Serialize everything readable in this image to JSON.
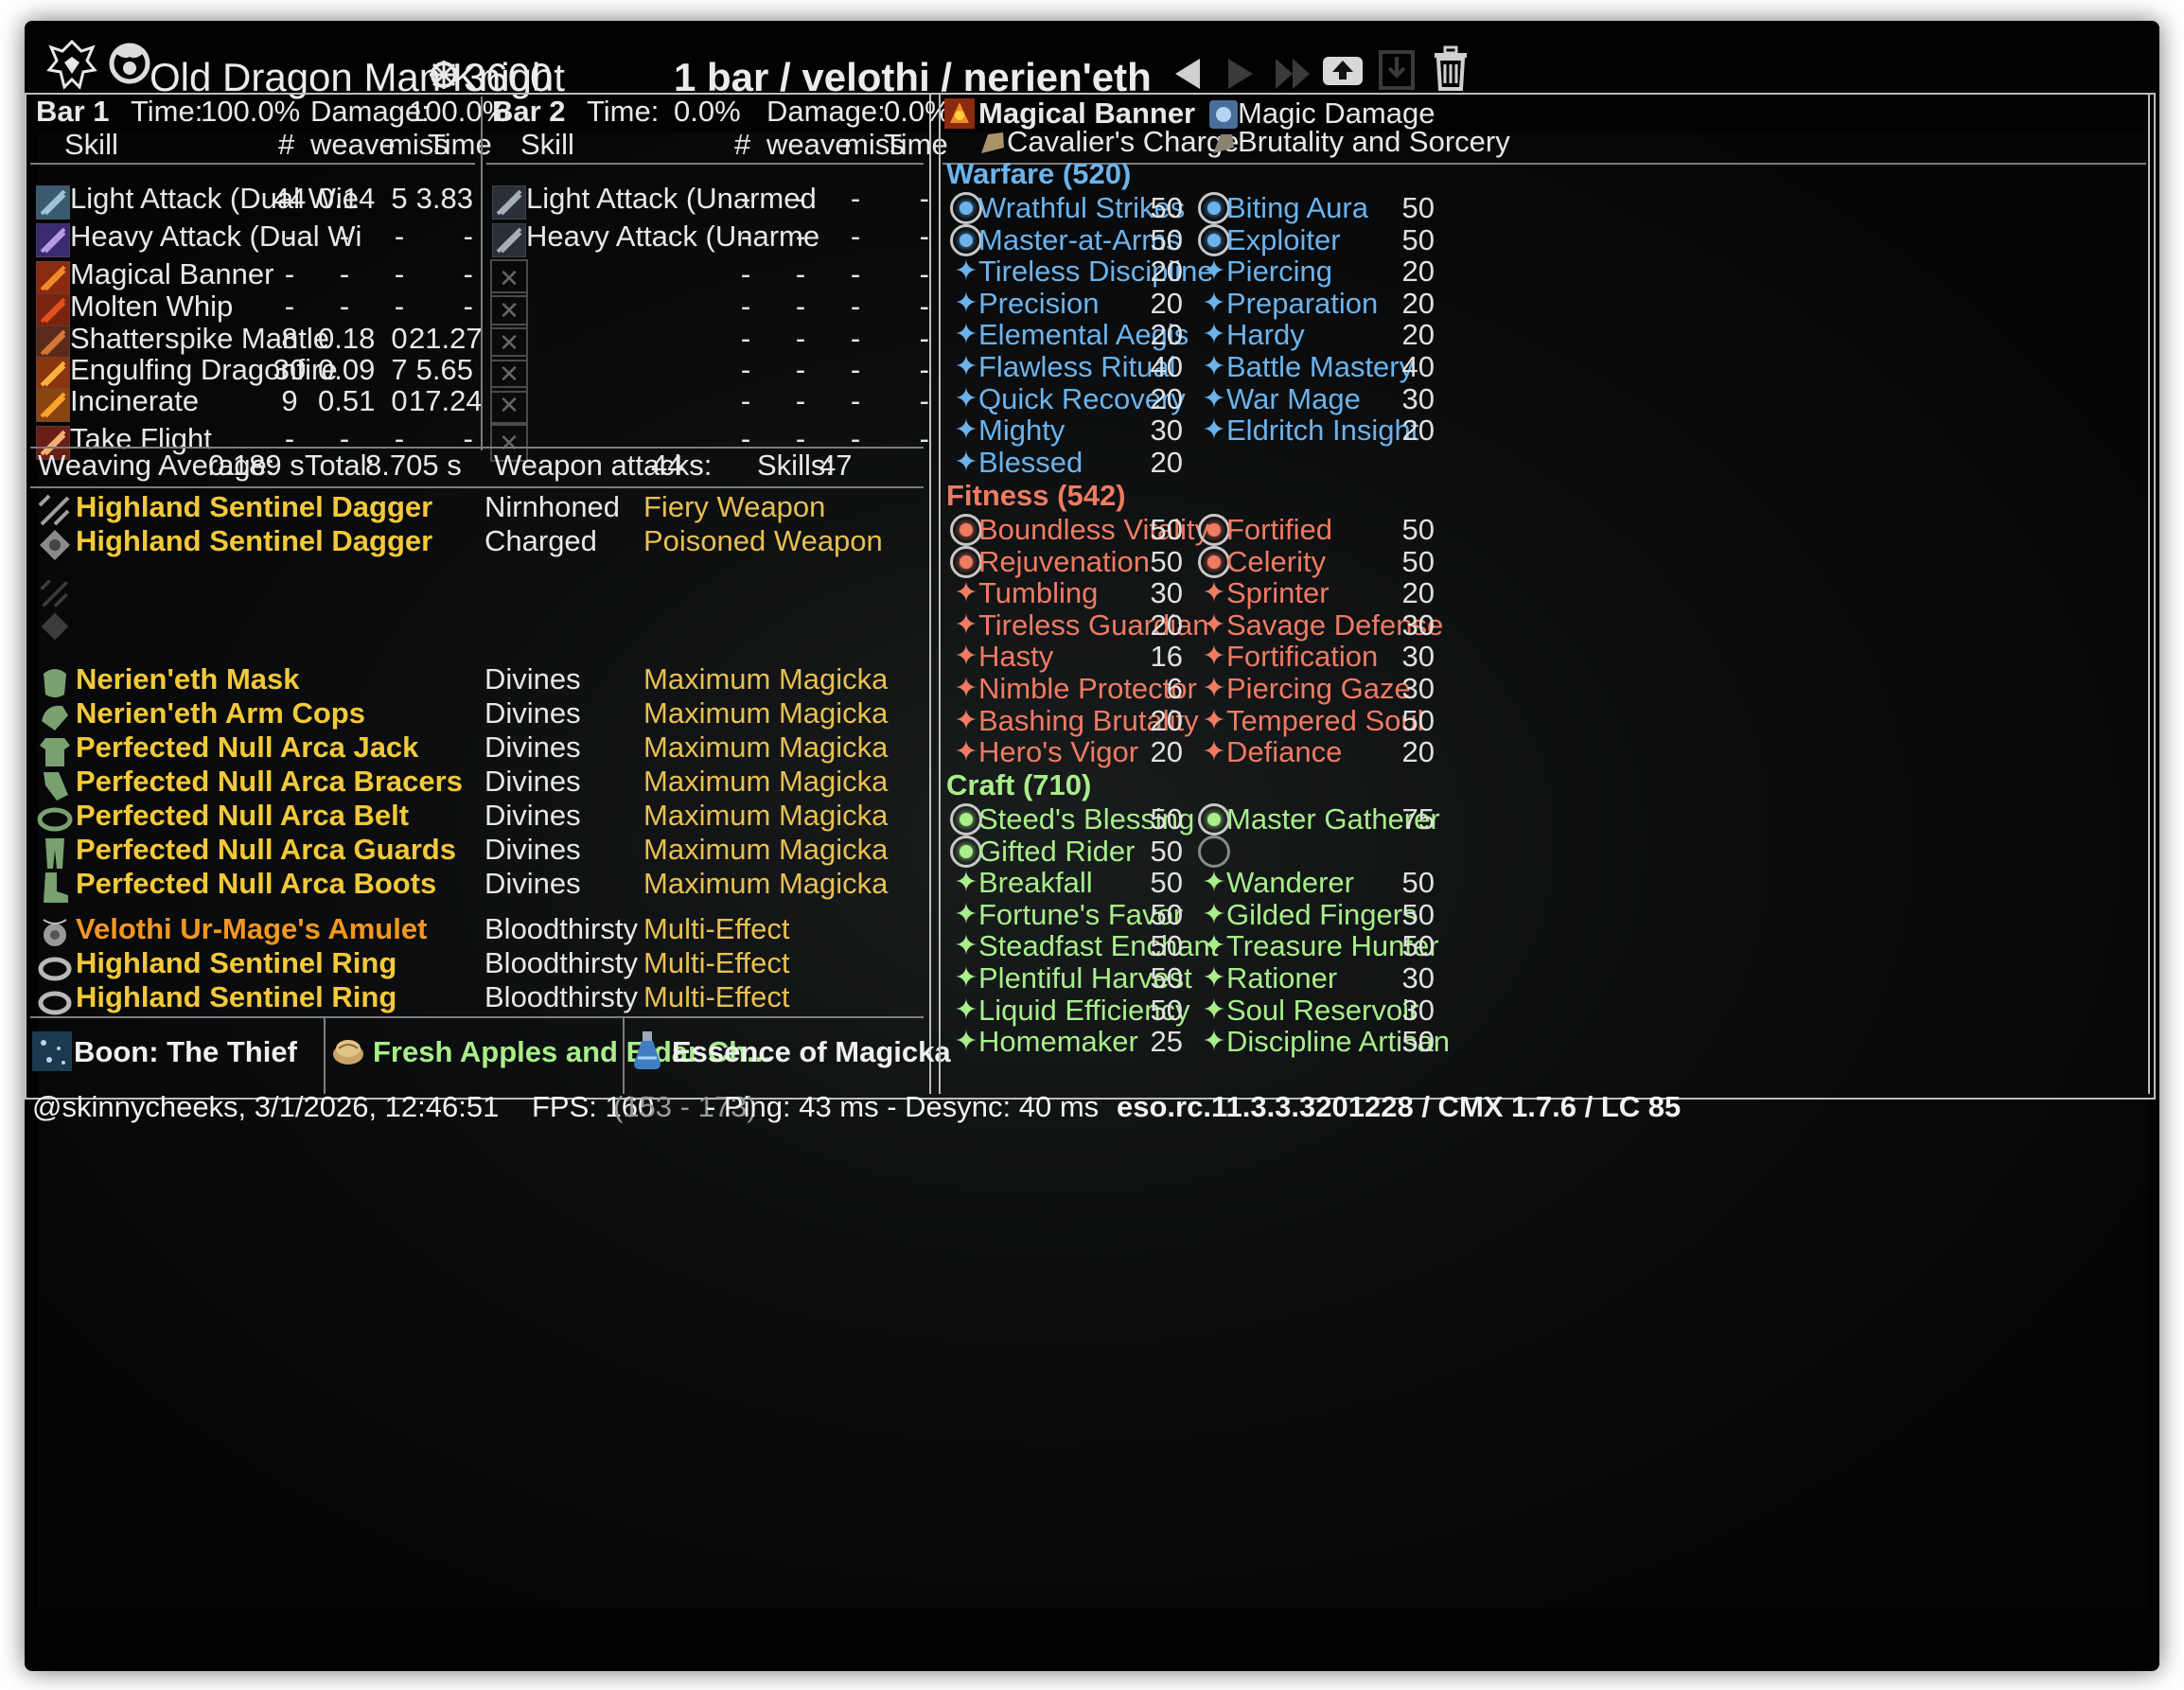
{
  "header": {
    "title": "Old Dragon Man Knight",
    "cp": "3600",
    "build": "1 bar / velothi / nerien'eth"
  },
  "bar1": {
    "title": "Bar 1",
    "time_label": "Time:",
    "time": "100.0%",
    "damage_label": "Damage:",
    "damage": "100.0%",
    "cols": {
      "skill": "Skill",
      "count": "#",
      "weave": "weave",
      "miss": "miss",
      "time": "Time"
    },
    "rows": [
      {
        "name": "Light Attack (Dual Wie",
        "count": "44",
        "weave": "0.14",
        "miss": "5",
        "time": "3.83"
      },
      {
        "name": "Heavy Attack (Dual Wi",
        "count": "-",
        "weave": "-",
        "miss": "-",
        "time": "-"
      },
      {
        "name": "Magical Banner",
        "count": "-",
        "weave": "-",
        "miss": "-",
        "time": "-"
      },
      {
        "name": "Molten Whip",
        "count": "-",
        "weave": "-",
        "miss": "-",
        "time": "-"
      },
      {
        "name": "Shatterspike Mantle",
        "count": "8",
        "weave": "0.18",
        "miss": "0",
        "time": "21.27"
      },
      {
        "name": "Engulfing Dragonfire",
        "count": "30",
        "weave": "0.09",
        "miss": "7",
        "time": "5.65"
      },
      {
        "name": "Incinerate",
        "count": "9",
        "weave": "0.51",
        "miss": "0",
        "time": "17.24"
      },
      {
        "name": "Take Flight",
        "count": "-",
        "weave": "-",
        "miss": "-",
        "time": "-"
      }
    ]
  },
  "bar2": {
    "title": "Bar 2",
    "time_label": "Time:",
    "time": "0.0%",
    "damage_label": "Damage:",
    "damage": "0.0%",
    "cols": {
      "skill": "Skill",
      "count": "#",
      "weave": "weave",
      "miss": "miss",
      "time": "Time"
    },
    "rows": [
      {
        "name": "Light Attack (Unarmed",
        "count": "-",
        "weave": "-",
        "miss": "-",
        "time": "-"
      },
      {
        "name": "Heavy Attack (Unarme",
        "count": "-",
        "weave": "-",
        "miss": "-",
        "time": "-"
      },
      {
        "name": "",
        "count": "-",
        "weave": "-",
        "miss": "-",
        "time": "-"
      },
      {
        "name": "",
        "count": "-",
        "weave": "-",
        "miss": "-",
        "time": "-"
      },
      {
        "name": "",
        "count": "-",
        "weave": "-",
        "miss": "-",
        "time": "-"
      },
      {
        "name": "",
        "count": "-",
        "weave": "-",
        "miss": "-",
        "time": "-"
      },
      {
        "name": "",
        "count": "-",
        "weave": "-",
        "miss": "-",
        "time": "-"
      },
      {
        "name": "",
        "count": "-",
        "weave": "-",
        "miss": "-",
        "time": "-"
      }
    ]
  },
  "summary": {
    "weaving_label": "Weaving Average:",
    "weaving": "0.189 s",
    "total_label": "Total:",
    "total": "8.705 s",
    "weapon_label": "Weapon attacks:",
    "weapon": "44",
    "skills_label": "Skills:",
    "skills": "47"
  },
  "gear": [
    {
      "name": "Highland Sentinel Dagger",
      "trait": "Nirnhoned",
      "enchant": "Fiery Weapon",
      "quality": "gold"
    },
    {
      "name": "Highland Sentinel Dagger",
      "trait": "Charged",
      "enchant": "Poisoned Weapon",
      "quality": "gold"
    },
    {
      "name": "Nerien'eth Mask",
      "trait": "Divines",
      "enchant": "Maximum Magicka",
      "quality": "gold"
    },
    {
      "name": "Nerien'eth Arm Cops",
      "trait": "Divines",
      "enchant": "Maximum Magicka",
      "quality": "gold"
    },
    {
      "name": "Perfected Null Arca Jack",
      "trait": "Divines",
      "enchant": "Maximum Magicka",
      "quality": "gold"
    },
    {
      "name": "Perfected Null Arca Bracers",
      "trait": "Divines",
      "enchant": "Maximum Magicka",
      "quality": "gold"
    },
    {
      "name": "Perfected Null Arca Belt",
      "trait": "Divines",
      "enchant": "Maximum Magicka",
      "quality": "gold"
    },
    {
      "name": "Perfected Null Arca Guards",
      "trait": "Divines",
      "enchant": "Maximum Magicka",
      "quality": "gold"
    },
    {
      "name": "Perfected Null Arca Boots",
      "trait": "Divines",
      "enchant": "Maximum Magicka",
      "quality": "gold"
    },
    {
      "name": "Velothi Ur-Mage's Amulet",
      "trait": "Bloodthirsty",
      "enchant": "Multi-Effect",
      "quality": "orange"
    },
    {
      "name": "Highland Sentinel Ring",
      "trait": "Bloodthirsty",
      "enchant": "Multi-Effect",
      "quality": "gold"
    },
    {
      "name": "Highland Sentinel Ring",
      "trait": "Bloodthirsty",
      "enchant": "Multi-Effect",
      "quality": "gold"
    }
  ],
  "buffs": {
    "boon": "Boon: The Thief",
    "food": "Fresh Apples and Eidar Ch...",
    "potion": "Essence of Magicka"
  },
  "champion": {
    "top": {
      "skill1": "Magical Banner",
      "skill2": "Cavalier's Charge",
      "stat1": "Magic Damage",
      "stat2": "Brutality and Sorcery"
    },
    "warfare": {
      "title": "Warfare (520)",
      "left": [
        [
          "Wrathful Strikes",
          "50"
        ],
        [
          "Master-at-Arms",
          "50"
        ],
        [
          "Tireless Discipline",
          "20"
        ],
        [
          "Precision",
          "20"
        ],
        [
          "Elemental Aegis",
          "20"
        ],
        [
          "Flawless Ritual",
          "40"
        ],
        [
          "Quick Recovery",
          "20"
        ],
        [
          "Mighty",
          "30"
        ],
        [
          "Blessed",
          "20"
        ]
      ],
      "right": [
        [
          "Biting Aura",
          "50"
        ],
        [
          "Exploiter",
          "50"
        ],
        [
          "Piercing",
          "20"
        ],
        [
          "Preparation",
          "20"
        ],
        [
          "Hardy",
          "20"
        ],
        [
          "Battle Mastery",
          "40"
        ],
        [
          "War Mage",
          "30"
        ],
        [
          "Eldritch Insight",
          "20"
        ]
      ]
    },
    "fitness": {
      "title": "Fitness (542)",
      "left": [
        [
          "Boundless Vitality",
          "50"
        ],
        [
          "Rejuvenation",
          "50"
        ],
        [
          "Tumbling",
          "30"
        ],
        [
          "Tireless Guardian",
          "20"
        ],
        [
          "Hasty",
          "16"
        ],
        [
          "Nimble Protector",
          "6"
        ],
        [
          "Bashing Brutality",
          "20"
        ],
        [
          "Hero's Vigor",
          "20"
        ]
      ],
      "right": [
        [
          "Fortified",
          "50"
        ],
        [
          "Celerity",
          "50"
        ],
        [
          "Sprinter",
          "20"
        ],
        [
          "Savage Defense",
          "30"
        ],
        [
          "Fortification",
          "30"
        ],
        [
          "Piercing Gaze",
          "30"
        ],
        [
          "Tempered Soul",
          "50"
        ],
        [
          "Defiance",
          "20"
        ]
      ]
    },
    "craft": {
      "title": "Craft (710)",
      "left": [
        [
          "Steed's Blessing",
          "50"
        ],
        [
          "Gifted Rider",
          "50"
        ],
        [
          "Breakfall",
          "50"
        ],
        [
          "Fortune's Favor",
          "50"
        ],
        [
          "Steadfast Enchant",
          "50"
        ],
        [
          "Plentiful Harvest",
          "50"
        ],
        [
          "Liquid Efficiency",
          "50"
        ],
        [
          "Homemaker",
          "25"
        ]
      ],
      "right": [
        [
          "Master Gatherer",
          "75"
        ],
        [
          "",
          ""
        ],
        [
          "Wanderer",
          "50"
        ],
        [
          "Gilded Fingers",
          "50"
        ],
        [
          "Treasure Hunter",
          "50"
        ],
        [
          "Rationer",
          "30"
        ],
        [
          "Soul Reservoir",
          "30"
        ],
        [
          "Discipline Artisan",
          "50"
        ]
      ]
    }
  },
  "footer": {
    "user": "@skinnycheeks, 3/1/2026, 12:46:51",
    "fps": "FPS: 160",
    "fps_range": "(153 - 173)",
    "ping": "- Ping: 43 ms - Desync: 40 ms",
    "version": "eso.rc.11.3.3.3201228 / CMX 1.7.6 / LC 85"
  },
  "colors": {
    "warfare": "#6cb3ec",
    "fitness": "#ee7b62",
    "craft": "#a8ee8a",
    "gold": "#f3c93a",
    "orange": "#f39722",
    "amber": "#e8c050"
  }
}
